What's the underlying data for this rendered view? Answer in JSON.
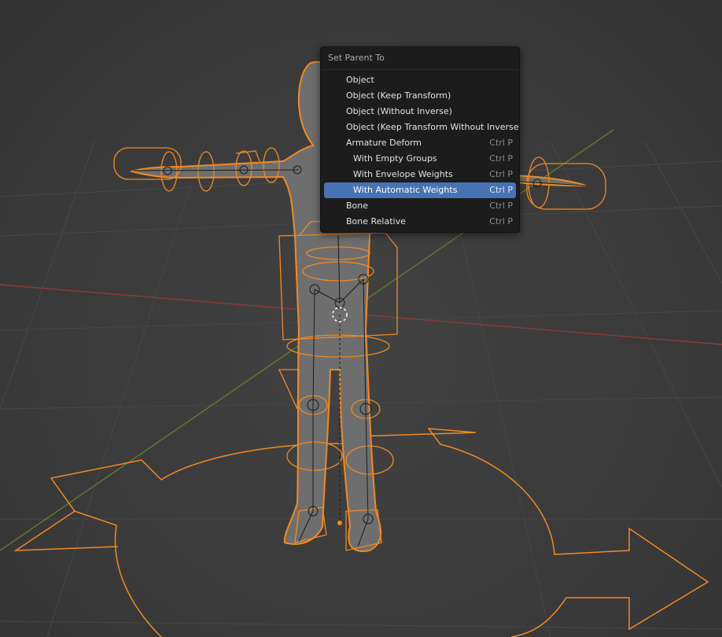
{
  "viewport": {
    "colors": {
      "background": "#3b3b3b",
      "grid": "#4a4a4a",
      "x_axis": "#8a3a3a",
      "y_axis": "#5d7a2e",
      "selection_outline": "#f08a24",
      "bone": "#1a1a1a",
      "mesh": "#6e6e6e"
    }
  },
  "menu": {
    "title": "Set Parent To",
    "items": [
      {
        "label": "Object",
        "shortcut": "",
        "sub": false,
        "active": false
      },
      {
        "label": "Object (Keep Transform)",
        "shortcut": "",
        "sub": false,
        "active": false
      },
      {
        "label": "Object (Without Inverse)",
        "shortcut": "",
        "sub": false,
        "active": false
      },
      {
        "label": "Object (Keep Transform Without Inverse)",
        "shortcut": "",
        "sub": false,
        "active": false
      },
      {
        "label": "Armature Deform",
        "shortcut": "Ctrl P",
        "sub": false,
        "active": false
      },
      {
        "label": "With Empty Groups",
        "shortcut": "Ctrl P",
        "sub": true,
        "active": false
      },
      {
        "label": "With Envelope Weights",
        "shortcut": "Ctrl P",
        "sub": true,
        "active": false
      },
      {
        "label": "With Automatic Weights",
        "shortcut": "Ctrl P",
        "sub": true,
        "active": true
      },
      {
        "label": "Bone",
        "shortcut": "Ctrl P",
        "sub": false,
        "active": false
      },
      {
        "label": "Bone Relative",
        "shortcut": "Ctrl P",
        "sub": false,
        "active": false
      }
    ]
  }
}
